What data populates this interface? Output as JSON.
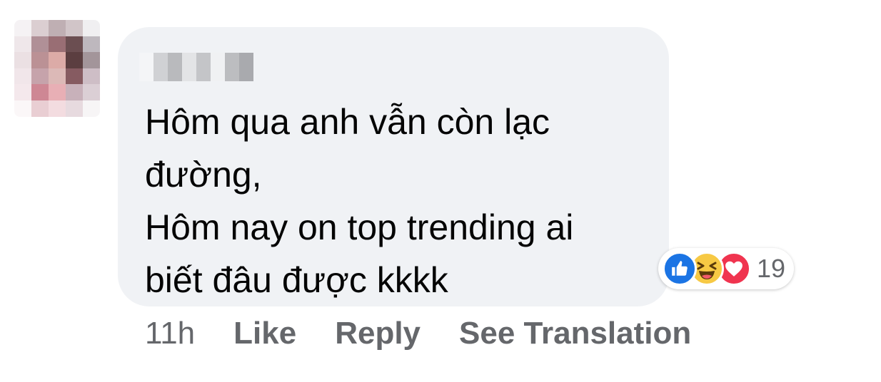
{
  "comment": {
    "lines": [
      "Hôm qua anh vẫn còn lạc",
      "đường,",
      "Hôm nay on top trending ai",
      "biết đâu được kkkk"
    ]
  },
  "reactions": {
    "icons": [
      "like-icon",
      "haha-icon",
      "love-icon"
    ],
    "count": "19",
    "colors": {
      "like": "#1b74e4",
      "haha": "#f7c944",
      "love": "#f0344f"
    }
  },
  "actions": {
    "timestamp": "11h",
    "like_label": "Like",
    "reply_label": "Reply",
    "translate_label": "See Translation"
  },
  "colors": {
    "bubble": "#f0f2f5",
    "text": "#050505",
    "secondary_text": "#65676b"
  }
}
